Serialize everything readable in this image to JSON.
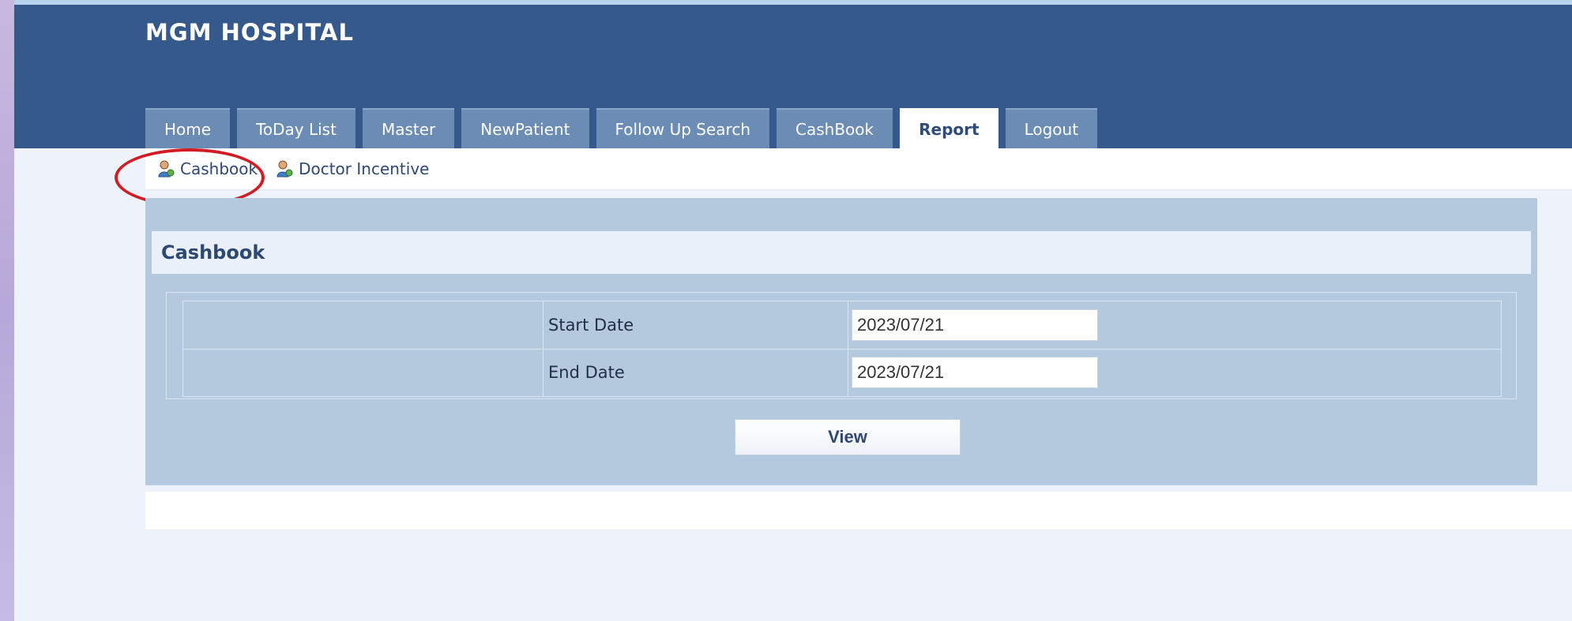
{
  "app": {
    "title": "MGM HOSPITAL"
  },
  "tabs": [
    {
      "label": "Home"
    },
    {
      "label": "ToDay List"
    },
    {
      "label": "Master"
    },
    {
      "label": "NewPatient"
    },
    {
      "label": "Follow Up Search"
    },
    {
      "label": "CashBook"
    },
    {
      "label": "Report"
    },
    {
      "label": "Logout"
    }
  ],
  "active_tab": "Report",
  "subnav": {
    "items": [
      {
        "label": "Cashbook",
        "icon": "user-icon"
      },
      {
        "label": "Doctor Incentive",
        "icon": "user-icon"
      }
    ]
  },
  "panel": {
    "title": "Cashbook",
    "start_date_label": "Start Date",
    "start_date_value": "2023/07/21",
    "end_date_label": "End Date",
    "end_date_value": "2023/07/21",
    "view_label": "View"
  },
  "colors": {
    "header": "#36598c",
    "tab": "#6b8cb4",
    "panel": "#b4c8de",
    "highlight": "#d21c24"
  }
}
